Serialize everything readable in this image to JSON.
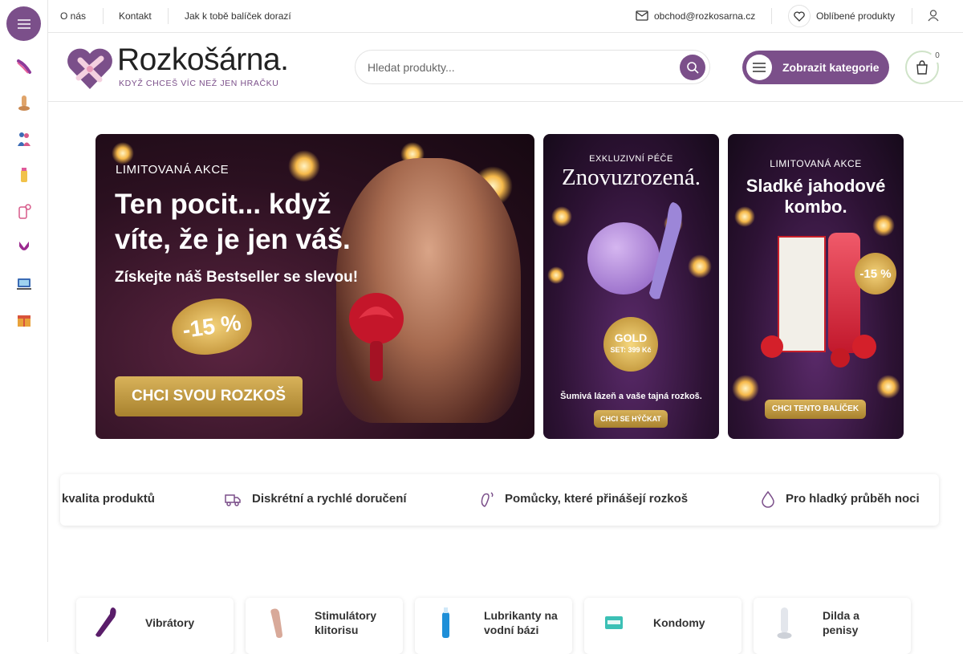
{
  "topbar": {
    "links": [
      "O nás",
      "Kontakt",
      "Jak k tobě balíček dorazí"
    ],
    "email": "obchod@rozkosarna.cz",
    "favorites": "Oblíbené produkty"
  },
  "header": {
    "logo_name": "Rozkošárna.",
    "logo_tagline": "KDYŽ CHCEŠ VÍC NEŽ JEN HRAČKU",
    "search_placeholder": "Hledat produkty...",
    "categories_button": "Zobrazit kategorie",
    "cart_count": "0"
  },
  "sidebar": {
    "icons": [
      "vibrator-icon",
      "dildo-icon",
      "couple-icon",
      "lubricant-icon",
      "cosmetics-icon",
      "lingerie-icon",
      "electro-icon",
      "gift-icon"
    ]
  },
  "banners": [
    {
      "kicker": "LIMITOVANÁ AKCE",
      "headline_1": "Ten pocit... když",
      "headline_2": "víte, že je jen váš.",
      "sub": "Získejte náš Bestseller se slevou!",
      "discount": "-15 %",
      "cta": "CHCI SVOU ROZKOŠ"
    },
    {
      "kicker": "EXKLUZIVNÍ PÉČE",
      "headline": "Znovuzrozená.",
      "badge_1": "GOLD",
      "badge_2": "SET: 399 Kč",
      "sub": "Šumivá lázeň a vaše tajná rozkoš.",
      "cta": "CHCI SE HÝČKAT"
    },
    {
      "kicker": "LIMITOVANÁ AKCE",
      "headline_1": "Sladké jahodové",
      "headline_2": "kombo.",
      "discount": "-15 %",
      "cta": "CHCI TENTO BALÍČEK"
    }
  ],
  "features": [
    "kvalita produktů",
    "Diskrétní a rychlé doručení",
    "Pomůcky, které přinášejí rozkoš",
    "Pro hladký průběh noci"
  ],
  "categories": [
    {
      "line1": "Vibrátory",
      "line2": ""
    },
    {
      "line1": "Stimulátory",
      "line2": "klitorisu"
    },
    {
      "line1": "Lubrikanty na",
      "line2": "vodní bázi"
    },
    {
      "line1": "Kondomy",
      "line2": ""
    },
    {
      "line1": "Dilda a",
      "line2": "penisy"
    }
  ],
  "colors": {
    "brand": "#7b4f8a",
    "text": "#333333",
    "gold": "#c9a24a"
  }
}
